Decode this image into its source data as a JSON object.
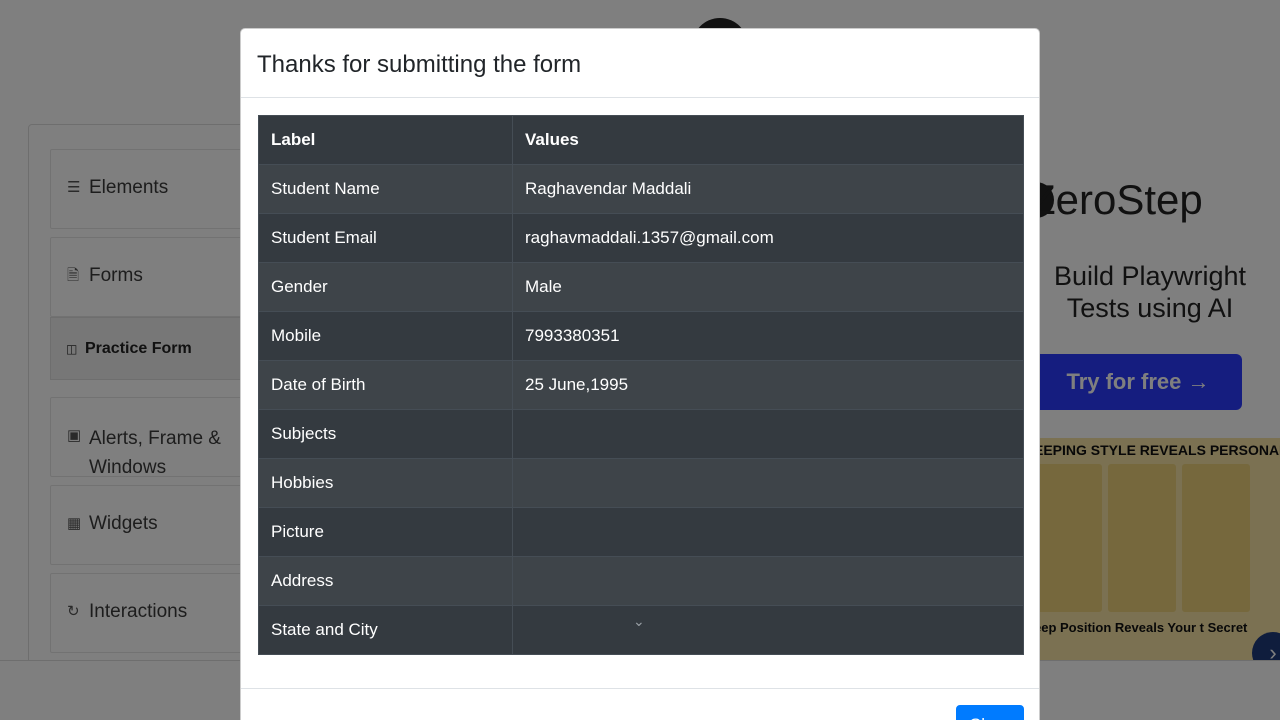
{
  "modal": {
    "title": "Thanks for submitting the form",
    "close_label": "Close",
    "table": {
      "headers": [
        "Label",
        "Values"
      ],
      "rows": [
        {
          "label": "Student Name",
          "value": "Raghavendar Maddali"
        },
        {
          "label": "Student Email",
          "value": "raghavmaddali.1357@gmail.com"
        },
        {
          "label": "Gender",
          "value": "Male"
        },
        {
          "label": "Mobile",
          "value": "7993380351"
        },
        {
          "label": "Date of Birth",
          "value": "25 June,1995"
        },
        {
          "label": "Subjects",
          "value": ""
        },
        {
          "label": "Hobbies",
          "value": ""
        },
        {
          "label": "Picture",
          "value": ""
        },
        {
          "label": "Address",
          "value": ""
        },
        {
          "label": "State and City",
          "value": ""
        }
      ]
    }
  },
  "sidebar": {
    "groups": [
      {
        "label": "Elements",
        "icon": "list-icon"
      },
      {
        "label": "Forms",
        "icon": "document-icon"
      },
      {
        "label": "Alerts, Frame & Windows",
        "icon": "window-icon"
      },
      {
        "label": "Widgets",
        "icon": "widgets-icon"
      },
      {
        "label": "Interactions",
        "icon": "interactions-icon"
      }
    ],
    "active_item": {
      "label": "Practice Form",
      "icon": "html5-icon"
    }
  },
  "ad": {
    "brand": "ZeroStep",
    "tagline": "Build Playwright Tests using AI",
    "cta": "Try for free →"
  },
  "ad2": {
    "headline": "EEPING STYLE REVEALS PERSONALIT",
    "subtitle": "eep Position Reveals Your t Secret"
  },
  "colors": {
    "table_bg": "#343a40",
    "primary": "#007bff",
    "backdrop": "rgba(0,0,0,0.5)"
  }
}
